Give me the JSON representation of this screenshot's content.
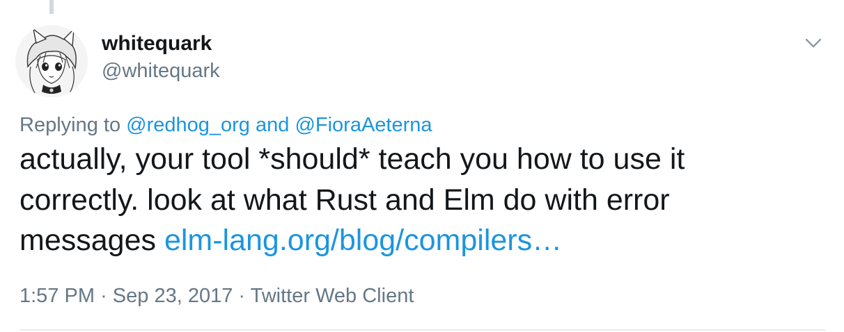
{
  "author": {
    "display_name": "whitequark",
    "handle": "@whitequark"
  },
  "reply": {
    "prefix": "Replying to",
    "mention_1": "@redhog_org",
    "conjunction": "and",
    "mention_2": "@FioraAeterna"
  },
  "tweet": {
    "text_line_1": "actually, your tool *should* teach you how to use it",
    "text_line_2": "correctly. look at what Rust and Elm do with error",
    "text_line_3": "messages",
    "link": "elm-lang.org/blog/compilers…"
  },
  "meta": {
    "time": "1:57 PM",
    "separator": "·",
    "date": "Sep 23, 2017",
    "client": "Twitter Web Client"
  },
  "icons": {
    "more": "chevron-down-icon",
    "avatar": "avatar-image"
  },
  "colors": {
    "link": "#1b95e0",
    "secondary_text": "#657786",
    "primary_text": "#14171a"
  }
}
